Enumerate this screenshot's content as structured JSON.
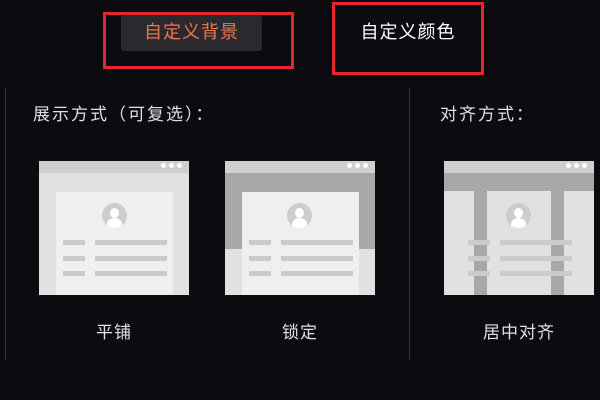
{
  "tabs": {
    "custom_background": "自定义背景",
    "custom_color": "自定义颜色"
  },
  "display_mode": {
    "heading": "展示方式（可复选）：",
    "options": [
      {
        "label": "平铺"
      },
      {
        "label": "锁定"
      }
    ]
  },
  "alignment": {
    "heading": "对齐方式：",
    "options": [
      {
        "label": "居中对齐"
      }
    ]
  },
  "colors": {
    "accent_text": "#f0744a",
    "highlight_border": "#e8252c",
    "background": "#0c0c10"
  }
}
